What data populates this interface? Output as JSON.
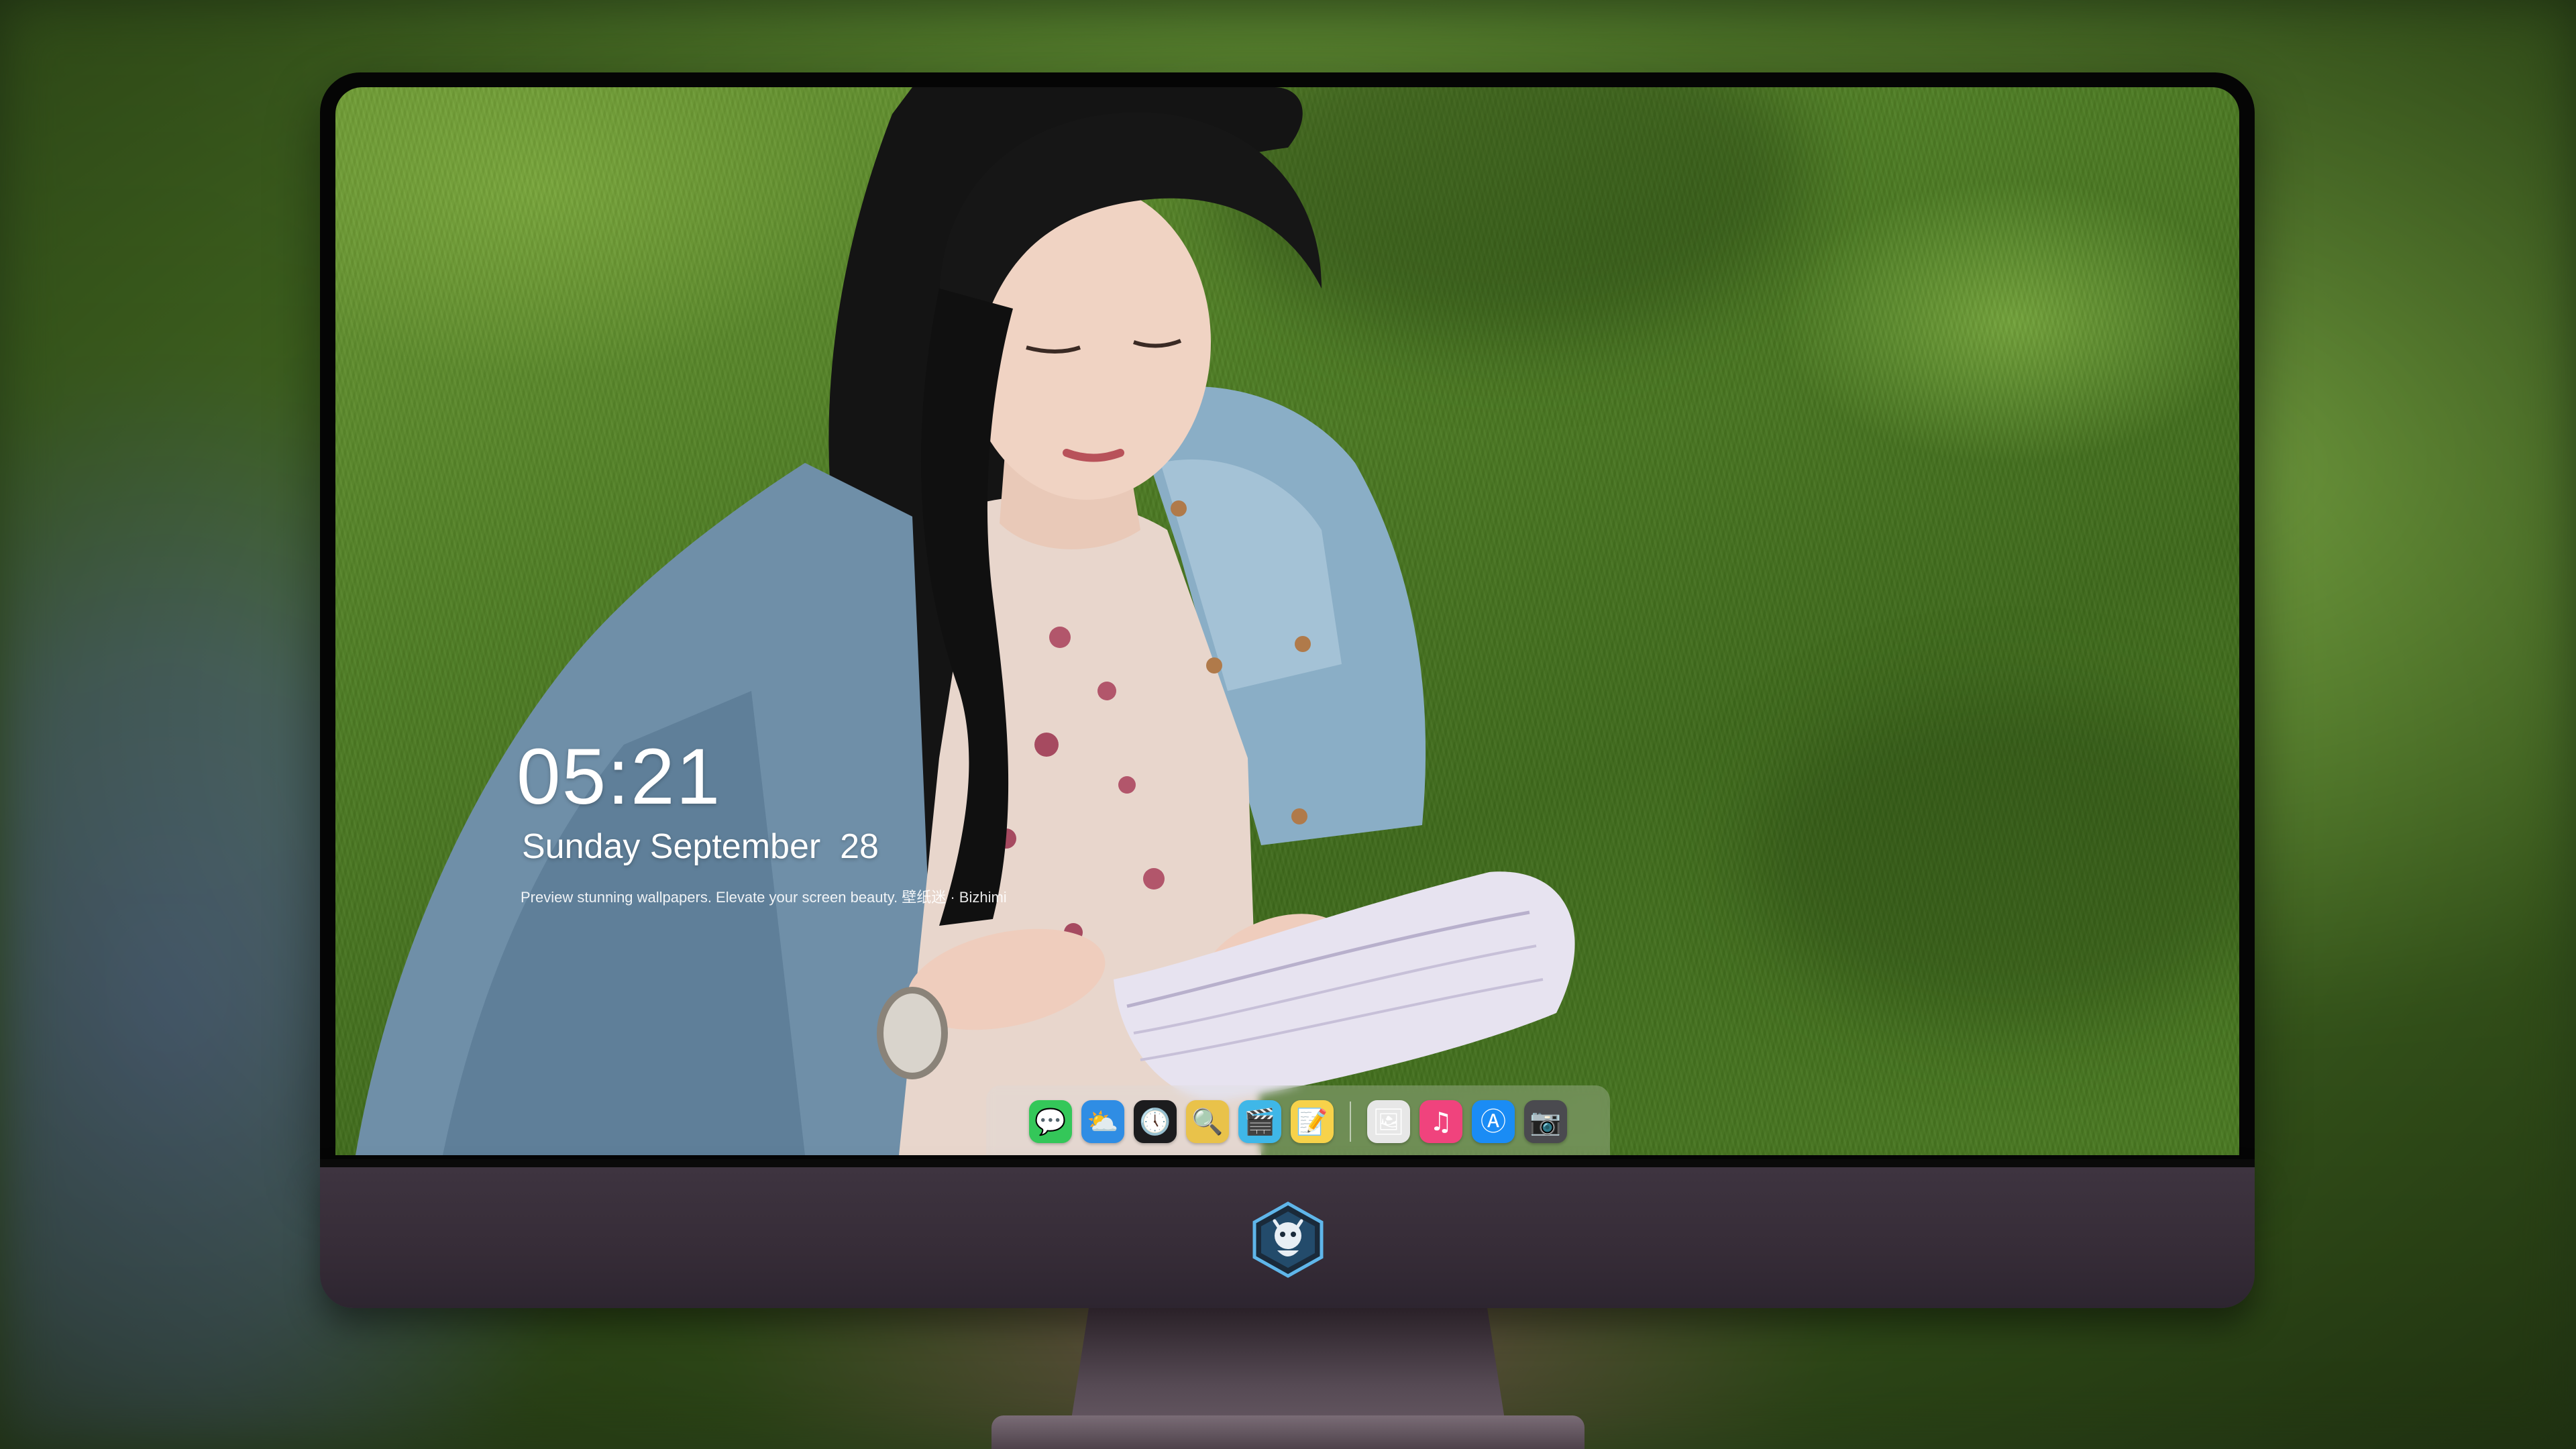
{
  "lockscreen": {
    "time": "05:21",
    "date": "Sunday September  28",
    "tagline": "Preview stunning wallpapers. Elevate your screen beauty. 壁纸迷 · Bizhimi"
  },
  "dock": {
    "items": [
      {
        "name": "messages-icon",
        "glyph": "💬",
        "color": "#34c759"
      },
      {
        "name": "weather-icon",
        "glyph": "⛅",
        "color": "#2f8de4"
      },
      {
        "name": "clock-icon",
        "glyph": "🕔",
        "color": "#1c1c1e"
      },
      {
        "name": "preview-icon",
        "glyph": "🔍",
        "color": "#e9c24a"
      },
      {
        "name": "clips-icon",
        "glyph": "🎬",
        "color": "#3fb7e8"
      },
      {
        "name": "notes-icon",
        "glyph": "📝",
        "color": "#f7d24a"
      },
      {
        "name": "photo-booth-icon",
        "glyph": "🖼",
        "color": "#e7e7e7"
      },
      {
        "name": "music-icon",
        "glyph": "♫",
        "color": "#f0437d"
      },
      {
        "name": "app-store-icon",
        "glyph": "Ⓐ",
        "color": "#1a8cf5"
      },
      {
        "name": "camera-icon",
        "glyph": "📷",
        "color": "#4a4a4f"
      }
    ],
    "separator_after": 6
  },
  "colors": {
    "monitor_chin": "#362c37",
    "bezel": "#050505",
    "grass": "#4e7d24"
  }
}
